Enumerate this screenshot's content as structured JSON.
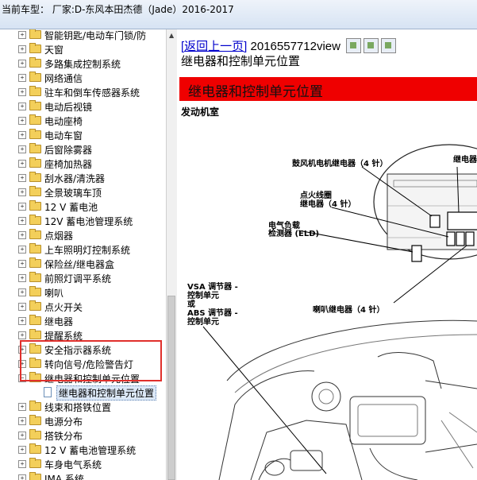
{
  "title_bar": {
    "text": "当前车型：  厂家:D-东风本田杰德（Jade）2016-2017"
  },
  "tree": {
    "items": [
      {
        "label": "智能钥匙/电动车门锁/防"
      },
      {
        "label": "天窗"
      },
      {
        "label": "多路集成控制系统"
      },
      {
        "label": "网络通信"
      },
      {
        "label": "驻车和倒车传感器系统"
      },
      {
        "label": "电动后视镜"
      },
      {
        "label": "电动座椅"
      },
      {
        "label": "电动车窗"
      },
      {
        "label": "后窗除雾器"
      },
      {
        "label": "座椅加热器"
      },
      {
        "label": "刮水器/清洗器"
      },
      {
        "label": "全景玻璃车顶"
      },
      {
        "label": "12 V 蓄电池"
      },
      {
        "label": "12V 蓄电池管理系统"
      },
      {
        "label": "点烟器"
      },
      {
        "label": "上车照明灯控制系统"
      },
      {
        "label": "保险丝/继电器盒"
      },
      {
        "label": "前照灯调平系统"
      },
      {
        "label": "喇叭"
      },
      {
        "label": "点火开关"
      },
      {
        "label": "继电器"
      },
      {
        "label": "提醒系统"
      },
      {
        "label": "安全指示器系统"
      },
      {
        "label": "转向信号/危险警告灯"
      },
      {
        "label": "继电器和控制单元位置",
        "expanded": true
      },
      {
        "label": "继电器和控制单元位置",
        "child": true,
        "selected": true
      },
      {
        "label": "线束和搭铁位置"
      },
      {
        "label": "电源分布"
      },
      {
        "label": "搭铁分布"
      },
      {
        "label": "12 V 蓄电池管理系统"
      },
      {
        "label": "车身电气系统"
      },
      {
        "label": "IMA 系统"
      }
    ]
  },
  "content": {
    "back_link": "[返回上一页]",
    "view_id": "2016557712view",
    "subtitle": "继电器和控制单元位置",
    "banner": "继电器和控制单元位置",
    "section": "发动机室",
    "labels": {
      "blower": "鼓风机电机继电器（4 针）",
      "relay_cut": "继电器",
      "ignition_1": "点火线圈",
      "ignition_2": "继电器（4 针）",
      "eld_1": "电气负载",
      "eld_2": "检测器 (ELD)",
      "vsa_1": "VSA 调节器 -",
      "vsa_2": "控制单元",
      "vsa_3": "或",
      "vsa_4": "ABS 调节器 -",
      "vsa_5": "控制单元",
      "horn": "喇叭继电器（4 针）"
    }
  },
  "colors": {
    "banner": "#ef0000",
    "highlight_box": "#e0302c",
    "link": "#0000cc"
  }
}
